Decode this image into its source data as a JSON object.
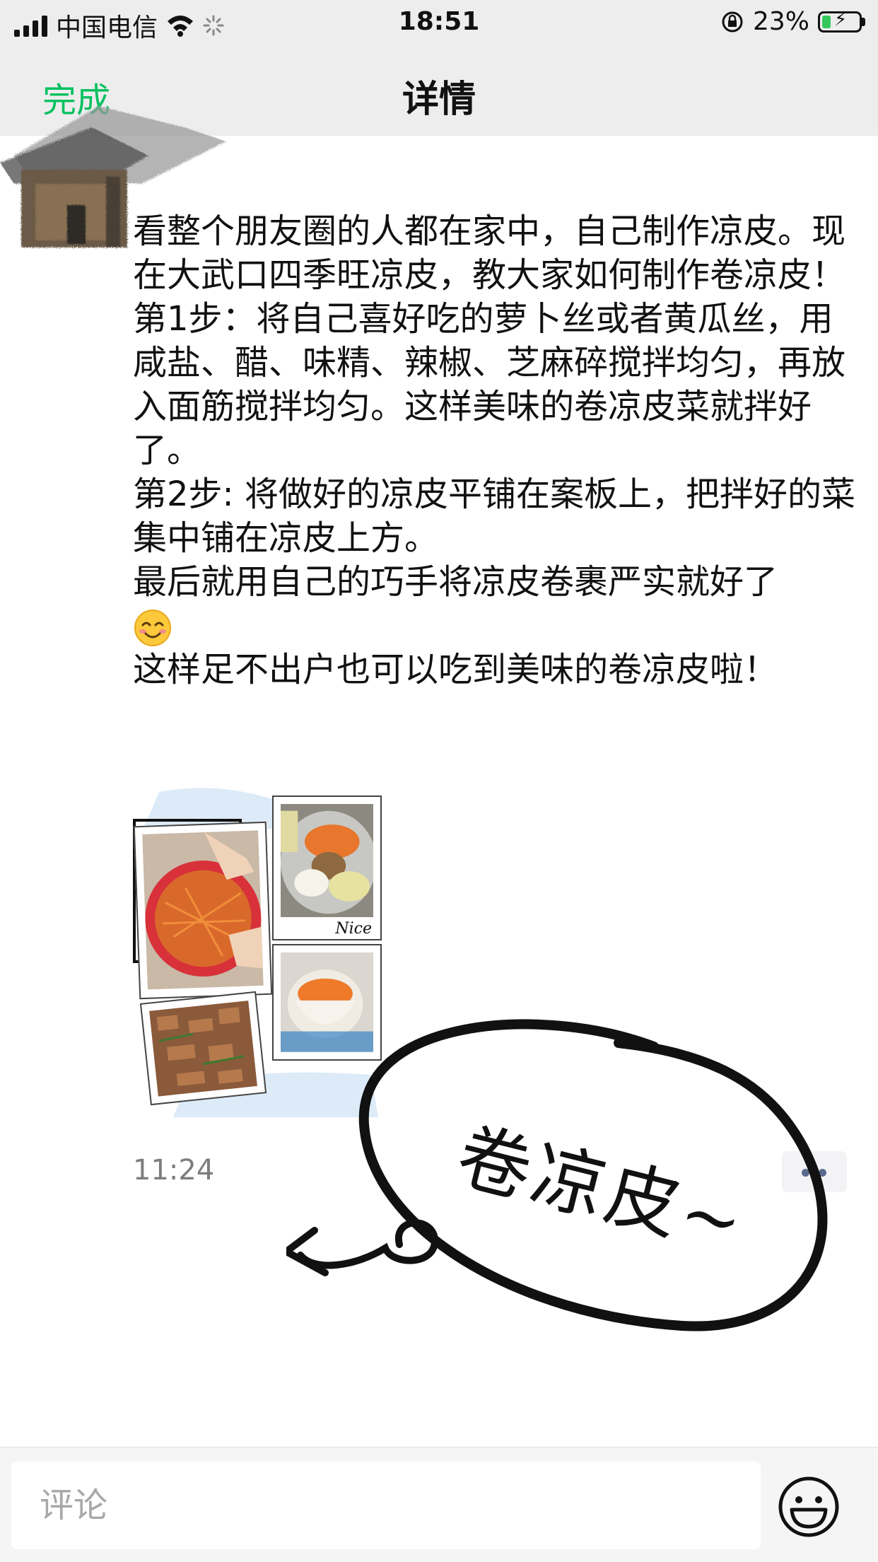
{
  "status_bar": {
    "carrier": "中国电信",
    "time": "18:51",
    "battery": "23%",
    "battery_level": 0.23
  },
  "nav": {
    "back_label": "完成",
    "title": "详情"
  },
  "post": {
    "paragraphs": [
      "看整个朋友圈的人都在家中，自己制作凉皮。现在大武口四季旺凉皮，教大家如何制作卷凉皮！",
      "第1步：将自己喜好吃的萝卜丝或者黄瓜丝，用咸盐、醋、味精、辣椒、芝麻碎搅拌均匀，再放入面筋搅拌均匀。这样美味的卷凉皮菜就拌好了。",
      "第2步: 将做好的凉皮平铺在案板上，把拌好的菜集中铺在凉皮上方。",
      "最后就用自己的巧手将凉皮卷裹严实就好了"
    ],
    "last_line": "这样足不出户也可以吃到美味的卷凉皮啦！",
    "emoji_icon": "smiling-face-emoji",
    "collage_caption": "Nice",
    "time": "11:24",
    "sticker_text": "卷凉皮~"
  },
  "comment": {
    "placeholder": "评论",
    "emoji_icon": "smiley-face-icon"
  },
  "colors": {
    "accent_green": "#07c160",
    "nav_background": "#ededed",
    "time_gray": "#7d7d7d",
    "link_blue": "#5a6a8f"
  }
}
